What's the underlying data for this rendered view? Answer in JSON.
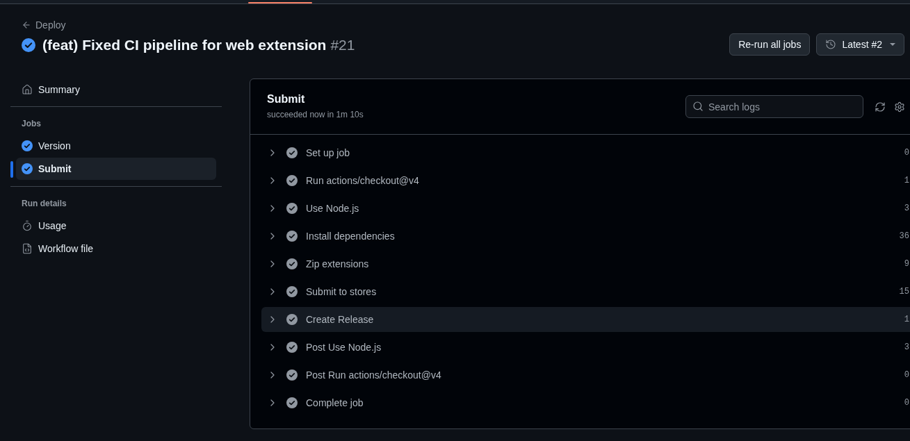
{
  "header": {
    "back_link": "Deploy",
    "completed": true,
    "title": "(feat) Fixed CI pipeline for web extension",
    "run_number": "#21",
    "buttons": [
      {
        "kind": "action",
        "label": "Re-run all jobs"
      },
      {
        "kind": "history_menu",
        "label": "Latest #2"
      }
    ]
  },
  "sidebar": {
    "sections": [
      {
        "items": [
          {
            "kind": "summary",
            "label": "Summary",
            "selected": false
          }
        ]
      },
      {
        "title": "Jobs",
        "items": [
          {
            "kind": "job",
            "label": "Version",
            "completed": true,
            "selected": false
          },
          {
            "kind": "job",
            "label": "Submit",
            "completed": true,
            "selected": true
          }
        ]
      },
      {
        "title": "Run details",
        "items": [
          {
            "kind": "usage",
            "label": "Usage",
            "selected": false
          },
          {
            "kind": "workflow",
            "label": "Workflow file",
            "selected": false
          }
        ]
      }
    ]
  },
  "job": {
    "title": "Submit",
    "subtitle": "succeeded now in 1m 10s",
    "search": {
      "placeholder": "Search logs"
    },
    "steps": [
      {
        "name": "Set up job",
        "completed": true,
        "expanded": false,
        "highlighted": false,
        "duration": "0"
      },
      {
        "name": "Run actions/checkout@v4",
        "completed": true,
        "expanded": false,
        "highlighted": false,
        "duration": "1"
      },
      {
        "name": "Use Node.js",
        "completed": true,
        "expanded": false,
        "highlighted": false,
        "duration": "3"
      },
      {
        "name": "Install dependencies",
        "completed": true,
        "expanded": false,
        "highlighted": false,
        "duration": "36"
      },
      {
        "name": "Zip extensions",
        "completed": true,
        "expanded": false,
        "highlighted": false,
        "duration": "9"
      },
      {
        "name": "Submit to stores",
        "completed": true,
        "expanded": false,
        "highlighted": false,
        "duration": "15"
      },
      {
        "name": "Create Release",
        "completed": true,
        "expanded": false,
        "highlighted": true,
        "duration": "1"
      },
      {
        "name": "Post Use Node.js",
        "completed": true,
        "expanded": false,
        "highlighted": false,
        "duration": "3"
      },
      {
        "name": "Post Run actions/checkout@v4",
        "completed": true,
        "expanded": false,
        "highlighted": false,
        "duration": "0"
      },
      {
        "name": "Complete job",
        "completed": true,
        "expanded": false,
        "highlighted": false,
        "duration": "0"
      }
    ]
  }
}
